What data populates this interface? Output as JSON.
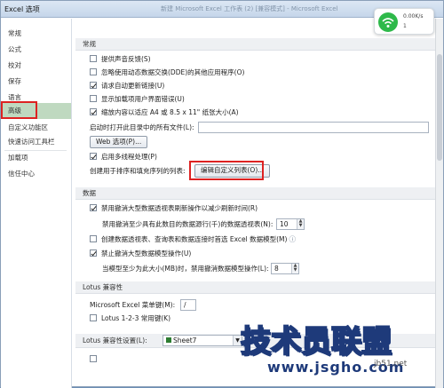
{
  "window": {
    "title": "Excel 选项",
    "faded_title": "新建 Microsoft Excel 工作表 (2) [兼容模式] - Microsoft Excel"
  },
  "sidebar": {
    "items": [
      {
        "label": "常规"
      },
      {
        "label": "公式"
      },
      {
        "label": "校对"
      },
      {
        "label": "保存"
      },
      {
        "label": "语言"
      },
      {
        "label": "高级"
      },
      {
        "label": "自定义功能区"
      },
      {
        "label": "快速访问工具栏"
      },
      {
        "label": "加载项"
      },
      {
        "label": "信任中心"
      }
    ],
    "selected": "高级"
  },
  "general": {
    "header": "常规",
    "options": [
      {
        "label": "提供声音反馈(S)",
        "checked": false
      },
      {
        "label": "忽略使用动态数据交换(DDE)的其他应用程序(O)",
        "checked": false
      },
      {
        "label": "请求自动更新链接(U)",
        "checked": true
      },
      {
        "label": "显示加载项用户界面错误(U)",
        "checked": false
      },
      {
        "label": "缩放内容以适应 A4 或 8.5 x 11\" 纸张大小(A)",
        "checked": true
      }
    ],
    "startup_label": "启动时打开此目录中的所有文件(L):",
    "startup_value": "",
    "web_options_button": "Web 选项(P)...",
    "multithread_label": "启用多线程处理(P)",
    "multithread_checked": true,
    "custom_list_label": "创建用于排序和填充序列的列表:",
    "custom_list_button": "编辑自定义列表(O)..."
  },
  "data": {
    "header": "数据",
    "opt1_label": "禁用撤消大型数据透视表刷新操作以减少刷新时间(R)",
    "opt1_checked": true,
    "rows_label": "禁用撤消至少具有此数目的数据源行(千)的数据透视表(N):",
    "rows_value": "10",
    "opt2_label": "创建数据透视表、查询表和数据连接时首选 Excel 数据模型(M)",
    "opt2_checked": false,
    "opt3_label": "禁止撤消大型数据模型操作(U)",
    "opt3_checked": true,
    "mb_label": "当模型至少为此大小(MB)时，禁用撤消数据模型操作(L):",
    "mb_value": "8"
  },
  "lotus": {
    "header": "Lotus 兼容性",
    "menu_key_label": "Microsoft Excel 菜单键(M):",
    "menu_key_value": "/",
    "nav_keys_label": "Lotus 1-2-3 常用键(K)",
    "nav_keys_checked": false
  },
  "lotus_settings": {
    "header": "Lotus 兼容性设置(L):",
    "sheet_value": "Sheet7"
  },
  "net_badge": {
    "speed": "0.00K/s",
    "count": "1"
  },
  "watermark": {
    "text": "技术员联盟",
    "url": "www.jsgho.com",
    "corner": "jb51.net"
  },
  "colors": {
    "selected_nav": "#bfd9c0",
    "highlight_box": "#d22222",
    "wifi_green": "#2eb94a",
    "watermark_blue": "#1e3a7a"
  }
}
